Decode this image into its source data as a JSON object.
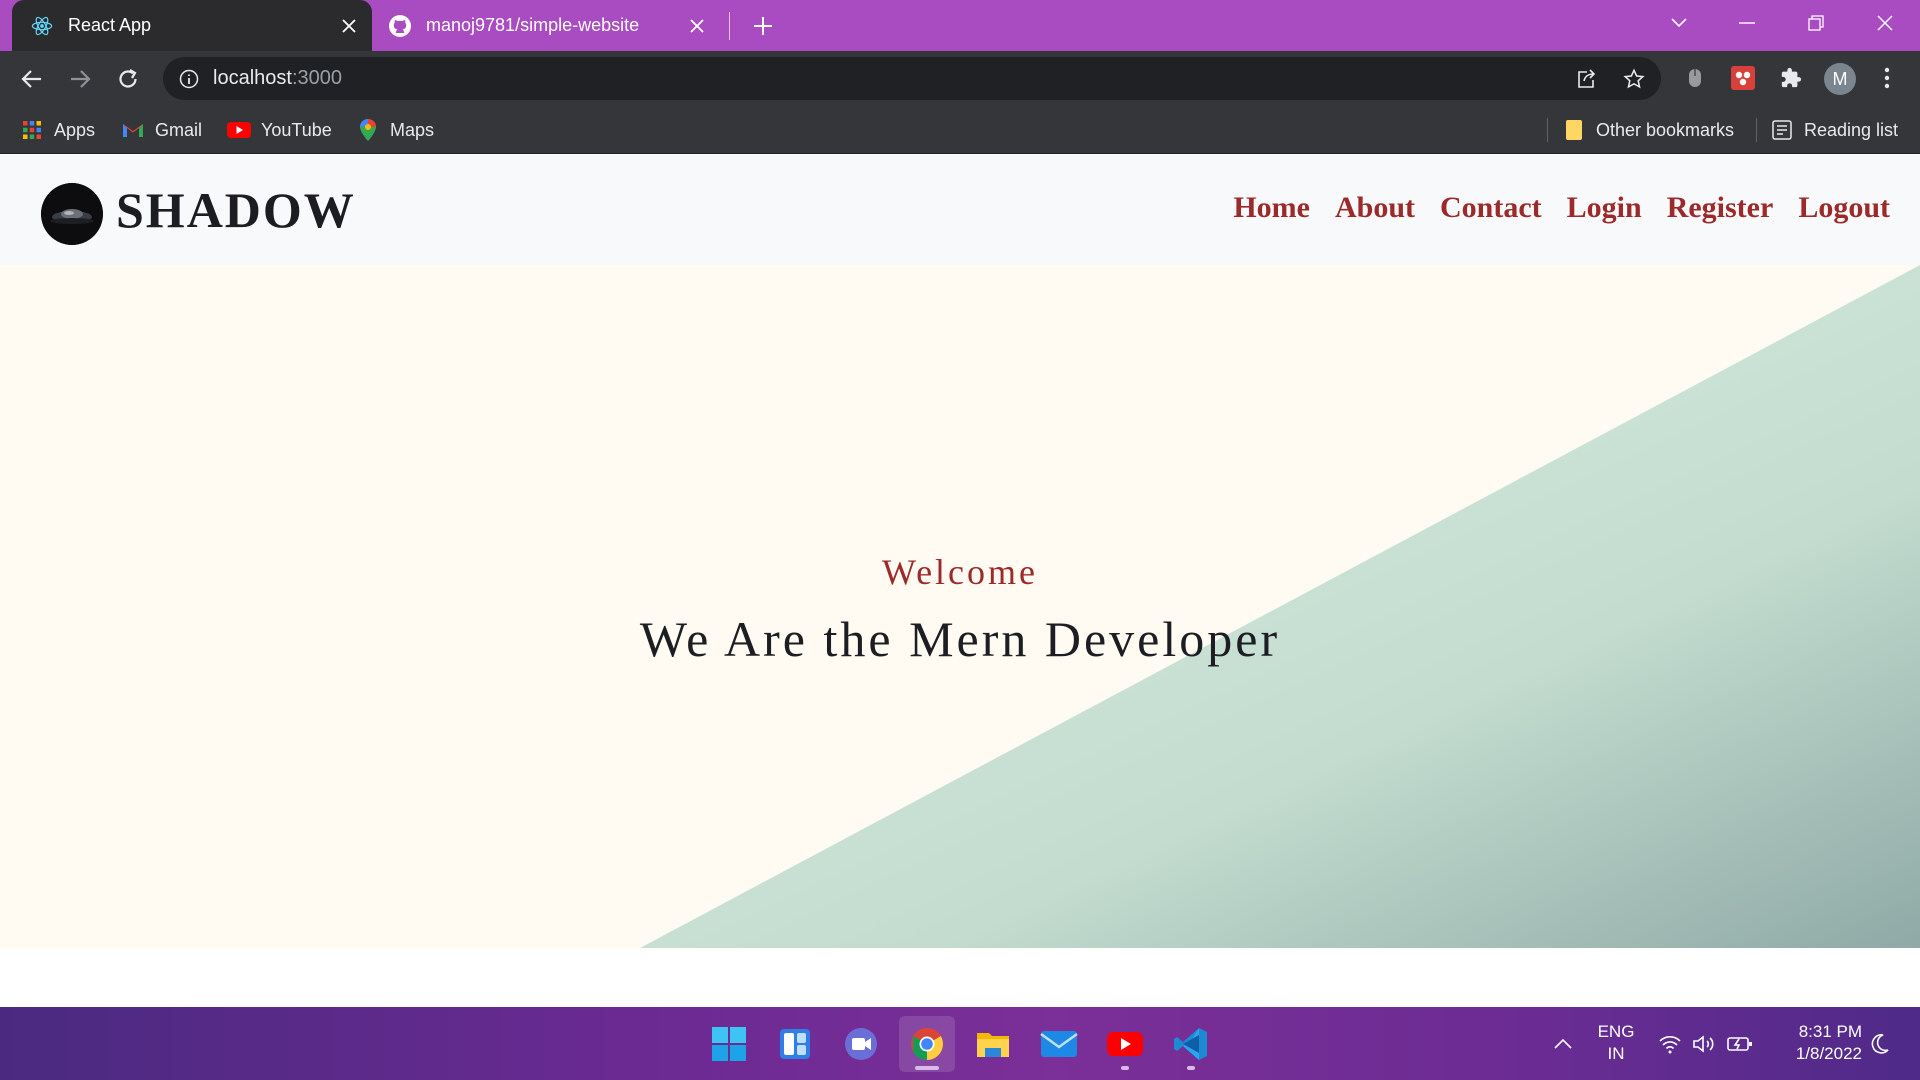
{
  "browser": {
    "tabs": [
      {
        "title": "React App",
        "active": true,
        "icon": "react-icon"
      },
      {
        "title": "manoj9781/simple-website",
        "active": false,
        "icon": "github-icon"
      }
    ],
    "address": {
      "host": "localhost",
      "port": ":3000"
    },
    "profile_initial": "M",
    "bookmarks": [
      {
        "label": "Apps",
        "icon": "apps-grid-icon"
      },
      {
        "label": "Gmail",
        "icon": "gmail-icon"
      },
      {
        "label": "YouTube",
        "icon": "youtube-icon"
      },
      {
        "label": "Maps",
        "icon": "maps-icon"
      }
    ],
    "other_bookmarks": "Other bookmarks",
    "reading_list": "Reading list",
    "colors": {
      "tabstrip": "#a94bc1",
      "toolbar": "#35363a",
      "omnibox": "#202124"
    }
  },
  "site": {
    "brand": "SHADOW",
    "nav": [
      {
        "label": "Home"
      },
      {
        "label": "About"
      },
      {
        "label": "Contact"
      },
      {
        "label": "Login"
      },
      {
        "label": "Register"
      },
      {
        "label": "Logout"
      }
    ],
    "hero": {
      "welcome": "Welcome",
      "title": "We Are the Mern Developer"
    },
    "colors": {
      "accent": "#9c2a2a",
      "hero_bg": "#fffbf2",
      "gradient_start": "#d4ece0",
      "gradient_end": "#8fa9a6"
    }
  },
  "taskbar": {
    "apps": [
      {
        "name": "start-icon"
      },
      {
        "name": "widgets-icon"
      },
      {
        "name": "teams-chat-icon"
      },
      {
        "name": "chrome-icon",
        "active": true
      },
      {
        "name": "file-explorer-icon"
      },
      {
        "name": "mail-icon"
      },
      {
        "name": "youtube-app-icon"
      },
      {
        "name": "vscode-icon"
      }
    ],
    "language": {
      "line1": "ENG",
      "line2": "IN"
    },
    "time": "8:31 PM",
    "date": "1/8/2022"
  }
}
